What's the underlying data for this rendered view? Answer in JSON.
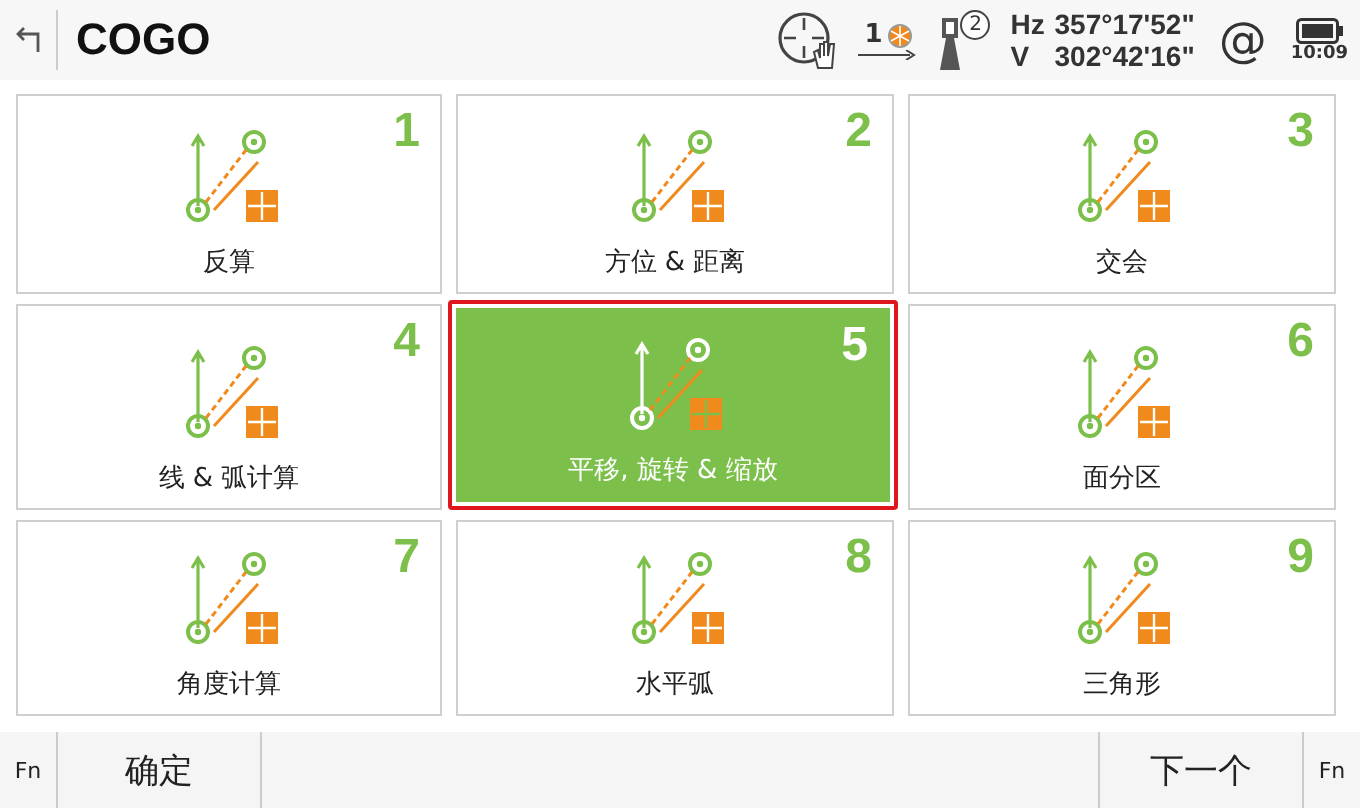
{
  "header": {
    "title": "COGO",
    "prism_number": "1",
    "face_number": "2",
    "hz_label": "Hz",
    "hz_value": "357°17'52\"",
    "v_label": "V",
    "v_value": "302°42'16\"",
    "at_sign": "@",
    "time": "10:09"
  },
  "tiles": [
    {
      "number": "1",
      "label": "反算",
      "selected": false
    },
    {
      "number": "2",
      "label": "方位 & 距离",
      "selected": false
    },
    {
      "number": "3",
      "label": "交会",
      "selected": false
    },
    {
      "number": "4",
      "label": "线 & 弧计算",
      "selected": false
    },
    {
      "number": "5",
      "label": "平移, 旋转 & 缩放",
      "selected": true
    },
    {
      "number": "6",
      "label": "面分区",
      "selected": false
    },
    {
      "number": "7",
      "label": "角度计算",
      "selected": false
    },
    {
      "number": "8",
      "label": "水平弧",
      "selected": false
    },
    {
      "number": "9",
      "label": "三角形",
      "selected": false
    }
  ],
  "softkeys": {
    "left_fn": "Fn",
    "ok": "确定",
    "next": "下一个",
    "right_fn": "Fn"
  }
}
